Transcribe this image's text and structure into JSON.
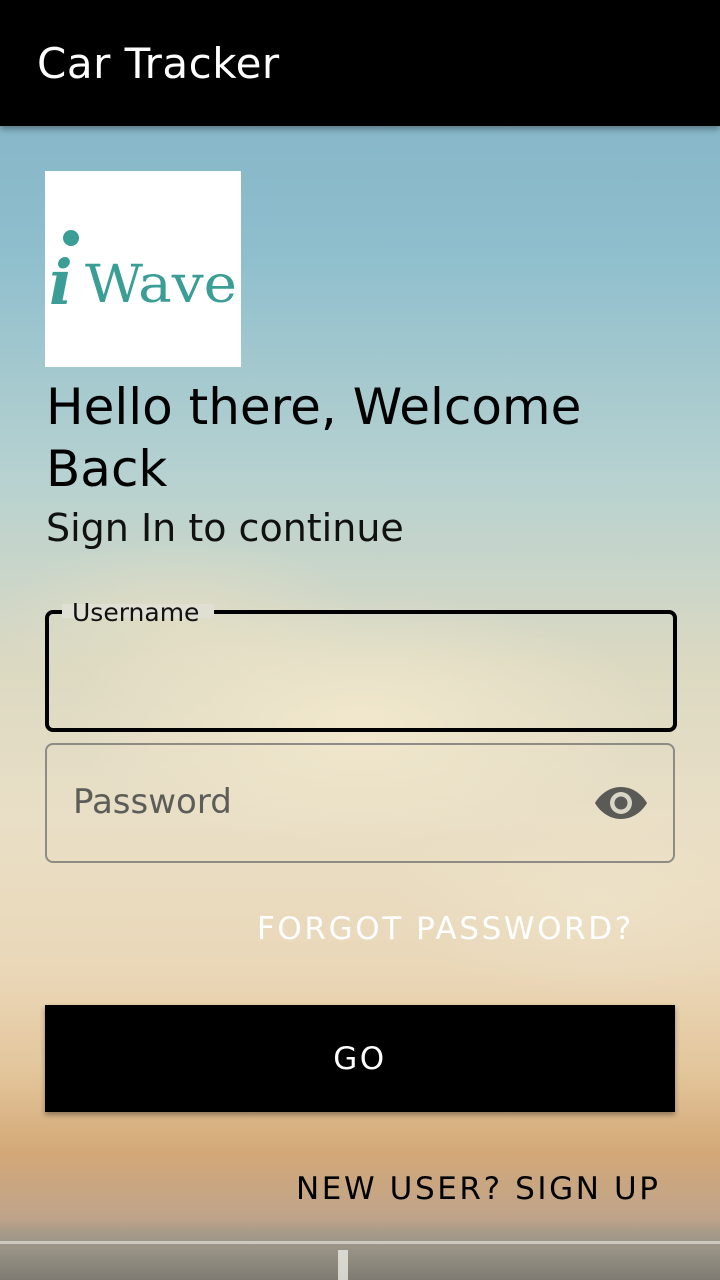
{
  "app_bar": {
    "title": "Car Tracker"
  },
  "logo": {
    "text_i": "i",
    "text_wave": "Wave",
    "color": "#3a9e96"
  },
  "welcome": {
    "heading": "Hello there, Welcome Back",
    "subtitle": "Sign In to continue"
  },
  "form": {
    "username": {
      "label": "Username",
      "value": ""
    },
    "password": {
      "placeholder": "Password",
      "value": "",
      "toggle_icon": "eye-icon"
    },
    "forgot_label": "FORGOT PASSWORD?",
    "submit_label": "GO",
    "signup_label": "NEW USER? SIGN UP"
  },
  "colors": {
    "app_bar": "#000000",
    "button": "#000000",
    "accent_text": "#ffffff"
  }
}
